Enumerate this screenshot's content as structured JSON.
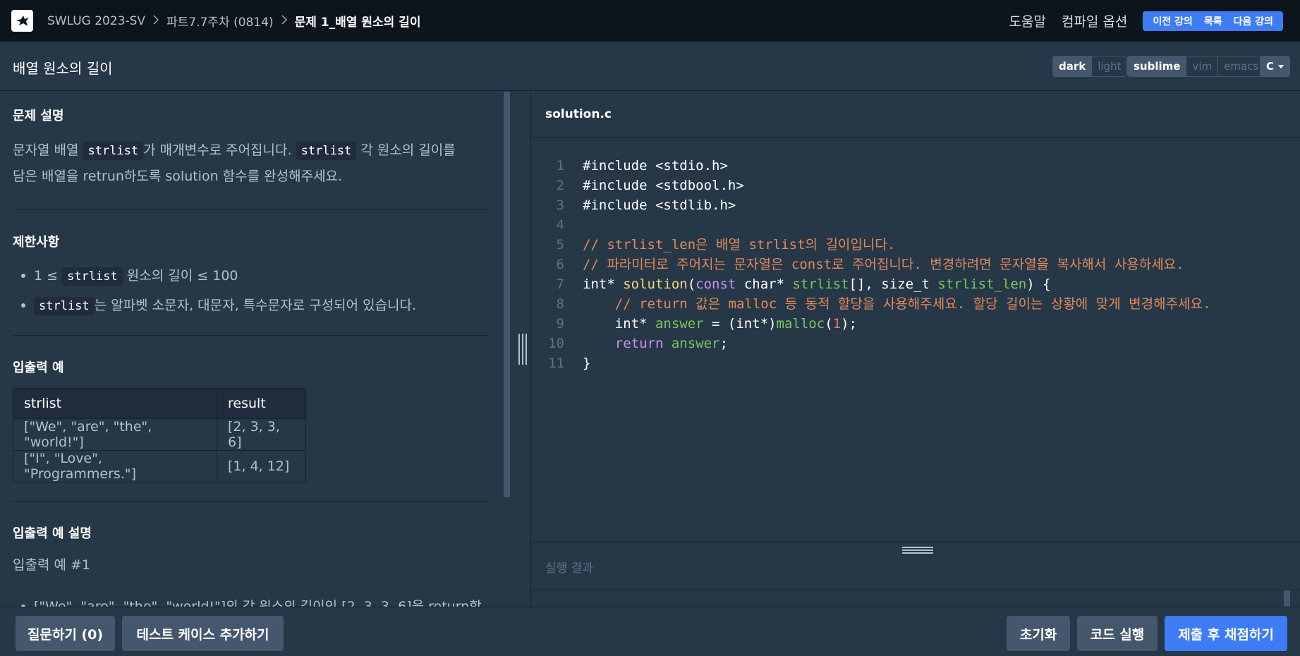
{
  "nav": {
    "breadcrumb": [
      "SWLUG 2023-SV",
      "파트7.7주차 (0814)",
      "문제 1_배열 원소의 길이"
    ],
    "help": "도움말",
    "compile_options": "컴파일 옵션",
    "prev": "이전 강의",
    "list": "목록",
    "next": "다음 강의"
  },
  "header": {
    "title": "배열 원소의 길이",
    "themes": [
      "dark",
      "light"
    ],
    "keymaps": [
      "sublime",
      "vim",
      "emacs"
    ],
    "language": "C"
  },
  "problem": {
    "desc_title": "문제 설명",
    "desc": {
      "p1": "문자열 배열 ",
      "c1": "strlist",
      "p2": "가 매개변수로 주어집니다. ",
      "c2": "strlist",
      "p3": " 각 원소의 길이를",
      "p4": "담은 배열을 retrun하도록 solution 함수를 완성해주세요."
    },
    "constraints_title": "제한사항",
    "constraints": [
      {
        "pre": "1 ≤ ",
        "code": "strlist",
        "post": " 원소의 길이 ≤ 100"
      },
      {
        "pre": "",
        "code": "strlist",
        "post": "는 알파벳 소문자, 대문자, 특수문자로 구성되어 있습니다."
      }
    ],
    "examples_title": "입출력 예",
    "table": {
      "headers": [
        "strlist",
        "result"
      ],
      "rows": [
        [
          "[\"We\", \"are\", \"the\", \"world!\"]",
          "[2, 3, 3, 6]"
        ],
        [
          "[\"I\", \"Love\", \"Programmers.\"]",
          "[1, 4, 12]"
        ]
      ]
    },
    "explain_title": "입출력 예 설명",
    "explain_sub": "입출력 예 #1",
    "explain_item": "[\"We\", \"are\", \"the\", \"world!\"]의 각 원소의 길이인 [2, 3, 3, 6]을 return합"
  },
  "editor": {
    "filename": "solution.c",
    "line_numbers": [
      "1",
      "2",
      "3",
      "4",
      "5",
      "6",
      "7",
      "8",
      "9",
      "10",
      "11"
    ],
    "lines": {
      "l1": "#include <stdio.h>",
      "l2": "#include <stdbool.h>",
      "l3": "#include <stdlib.h>",
      "l5": "// strlist_len은 배열 strlist의 길이입니다.",
      "l6": "// 파라미터로 주어지는 문자열은 const로 주어집니다. 변경하려면 문자열을 복사해서 사용하세요.",
      "l7a": "int* ",
      "l7b": "solution",
      "l7c": "(",
      "l7d": "const",
      "l7e": " char* ",
      "l7f": "strlist",
      "l7g": "[], size_t ",
      "l7h": "strlist_len",
      "l7i": ") {",
      "l8": "    // return 값은 malloc 등 동적 할당을 사용해주세요. 할당 길이는 상황에 맞게 변경해주세요.",
      "l9a": "    int* ",
      "l9b": "answer",
      "l9c": " = (int*)",
      "l9d": "malloc",
      "l9e": "(",
      "l9f": "1",
      "l9g": ");",
      "l10a": "    ",
      "l10b": "return",
      "l10c": " ",
      "l10d": "answer",
      "l10e": ";",
      "l11": "}"
    },
    "result_label": "실행 결과"
  },
  "footer": {
    "ask": "질문하기 (0)",
    "add_test": "테스트 케이스 추가하기",
    "reset": "초기화",
    "run": "코드 실행",
    "submit": "제출 후 채점하기"
  }
}
